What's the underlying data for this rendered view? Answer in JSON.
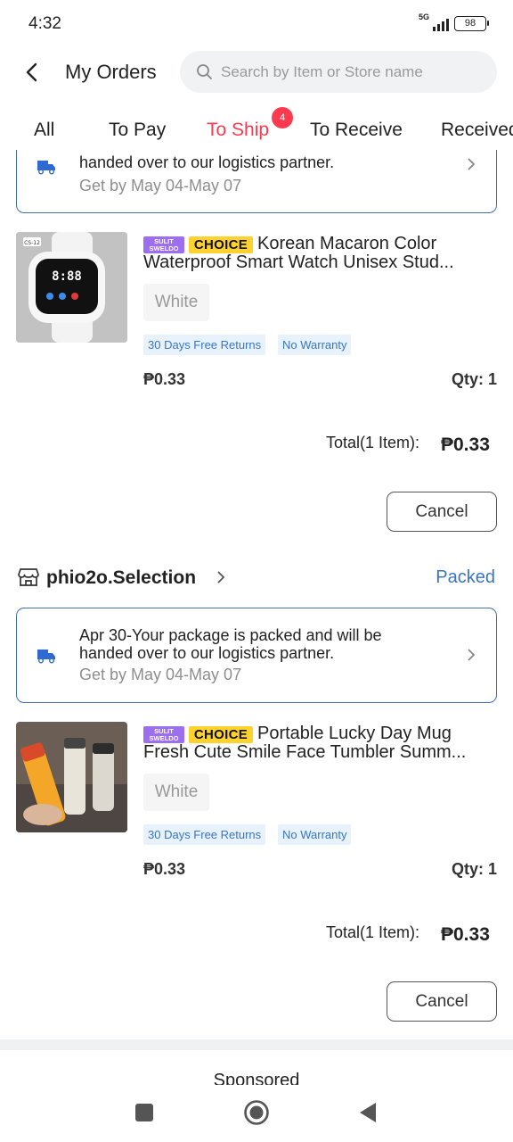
{
  "status_bar": {
    "time": "4:32",
    "network": "5G",
    "battery": "98"
  },
  "header": {
    "title": "My Orders",
    "search_placeholder": "Search by Item or Store name"
  },
  "tabs": [
    {
      "label": "All"
    },
    {
      "label": "To Pay"
    },
    {
      "label": "To Ship",
      "active": true,
      "badge": "4"
    },
    {
      "label": "To Receive"
    },
    {
      "label": "Received"
    }
  ],
  "order1": {
    "notice": {
      "message_line2": "handed over to our logistics partner.",
      "get_by": "Get by May 04-May 07"
    },
    "item": {
      "badge_sulit": "SULIT SWELDO",
      "badge_choice": "CHOICE",
      "title_line1": "Korean Macaron Color",
      "title_line2": "Waterproof Smart Watch Unisex Stud...",
      "variant": "White",
      "tags": [
        "30 Days Free Returns",
        "No Warranty"
      ],
      "price": "₱0.33",
      "qty": "Qty: 1"
    },
    "total_label": "Total(1 Item):",
    "total_value": "₱0.33",
    "cancel_label": "Cancel"
  },
  "order2": {
    "store_name": "phio2o.Selection",
    "status": "Packed",
    "notice": {
      "message_line1": "Apr 30-Your package is packed and will be",
      "message_line2": "handed over to our logistics partner.",
      "get_by": "Get by May 04-May 07"
    },
    "item": {
      "badge_sulit": "SULIT SWELDO",
      "badge_choice": "CHOICE",
      "title_line1": "Portable Lucky Day Mug",
      "title_line2": "Fresh Cute Smile Face Tumbler Summ...",
      "variant": "White",
      "tags": [
        "30 Days Free Returns",
        "No Warranty"
      ],
      "price": "₱0.33",
      "qty": "Qty: 1"
    },
    "total_label": "Total(1 Item):",
    "total_value": "₱0.33",
    "cancel_label": "Cancel"
  },
  "sponsored_label": "Sponsored",
  "colors": {
    "accent_red": "#ff3a4f",
    "link_blue": "#3a75c4",
    "choice_yellow": "#ffd22d",
    "sulit_purple": "#9d6ef0"
  },
  "icons": [
    "back-arrow-icon",
    "search-icon",
    "truck-icon",
    "chevron-right-icon",
    "store-icon",
    "nav-recents-icon",
    "nav-home-icon",
    "nav-back-icon"
  ]
}
